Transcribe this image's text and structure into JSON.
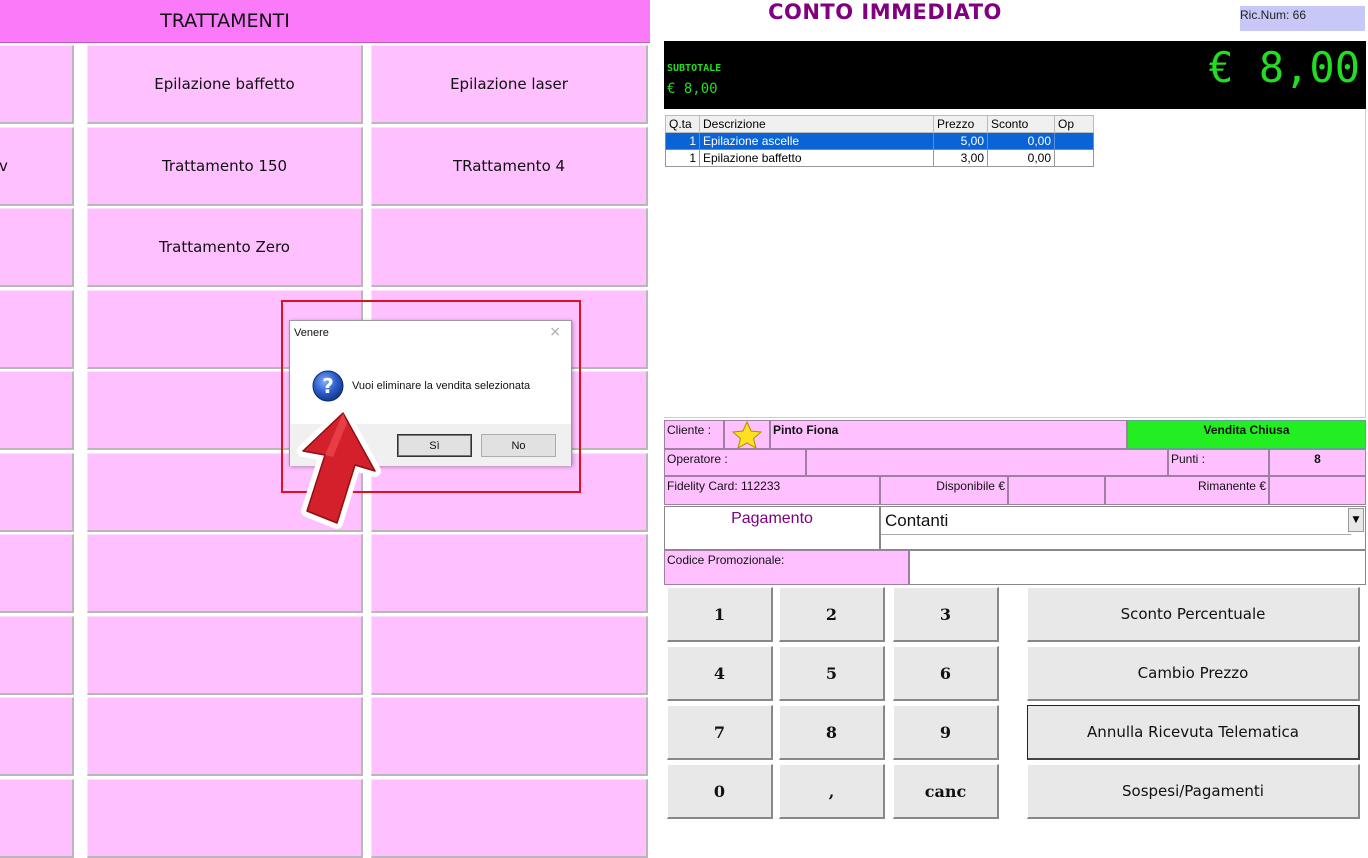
{
  "left_panel": {
    "header": "TRATTAMENTI",
    "buttons": [
      [
        "",
        "Epilazione baffetto",
        "Epilazione laser"
      ],
      [
        "v",
        "Trattamento 150",
        "TRattamento 4"
      ],
      [
        "",
        "Trattamento Zero",
        ""
      ],
      [
        "",
        "",
        ""
      ],
      [
        "",
        "",
        ""
      ],
      [
        "",
        "",
        ""
      ],
      [
        "",
        "",
        ""
      ],
      [
        "",
        "",
        ""
      ],
      [
        "",
        "",
        ""
      ],
      [
        "",
        "",
        ""
      ]
    ]
  },
  "header": {
    "title": "CONTO IMMEDIATO",
    "ric_num": "Ric.Num: 66"
  },
  "display": {
    "total": "€ 8,00",
    "subtotal_label": "SUBTOTALE",
    "subtotal_value": "€ 8,00",
    "text_color": "#22dd22"
  },
  "sale_table": {
    "columns": [
      "Q.ta",
      "Descrizione",
      "Prezzo",
      "Sconto",
      "Op"
    ],
    "rows": [
      {
        "qta": "1",
        "descrizione": "Epilazione ascelle",
        "prezzo": "5,00",
        "sconto": "0,00",
        "op": "",
        "selected": true
      },
      {
        "qta": "1",
        "descrizione": "Epilazione baffetto",
        "prezzo": "3,00",
        "sconto": "0,00",
        "op": "",
        "selected": false
      }
    ]
  },
  "customer": {
    "cliente_label": "Cliente :",
    "cliente_name": "Pinto Fiona",
    "status": "Vendita Chiusa",
    "status_color": "#22ee22",
    "operatore_label": "Operatore :",
    "operatore_value": "",
    "punti_label": "Punti :",
    "punti_value": "8",
    "fidelity_label": "Fidelity Card: 112233",
    "disponibile_label": "Disponibile €",
    "disponibile_value": "",
    "rimanente_label": "Rimanente €",
    "rimanente_value": ""
  },
  "payment": {
    "label": "Pagamento",
    "selected": "Contanti",
    "promo_label": "Codice Promozionale:",
    "promo_value": ""
  },
  "keypad": {
    "keys": [
      "1",
      "2",
      "3",
      "4",
      "5",
      "6",
      "7",
      "8",
      "9",
      "0",
      ",",
      "canc"
    ],
    "functions": [
      "Sconto Percentuale",
      "Cambio Prezzo",
      "Annulla Ricevuta Telematica",
      "Sospesi/Pagamenti"
    ]
  },
  "dialog": {
    "title": "Venere",
    "message": "Vuoi eliminare la vendita selezionata",
    "yes_label": "Sì",
    "no_label": "No",
    "close_glyph": "×",
    "icon": "question-icon"
  },
  "colors": {
    "header_magenta": "#fa7afa",
    "button_pink": "#ffc0ff",
    "title_purple": "#800080",
    "highlight_red": "#e01020",
    "arrow_red": "#d4202a"
  }
}
